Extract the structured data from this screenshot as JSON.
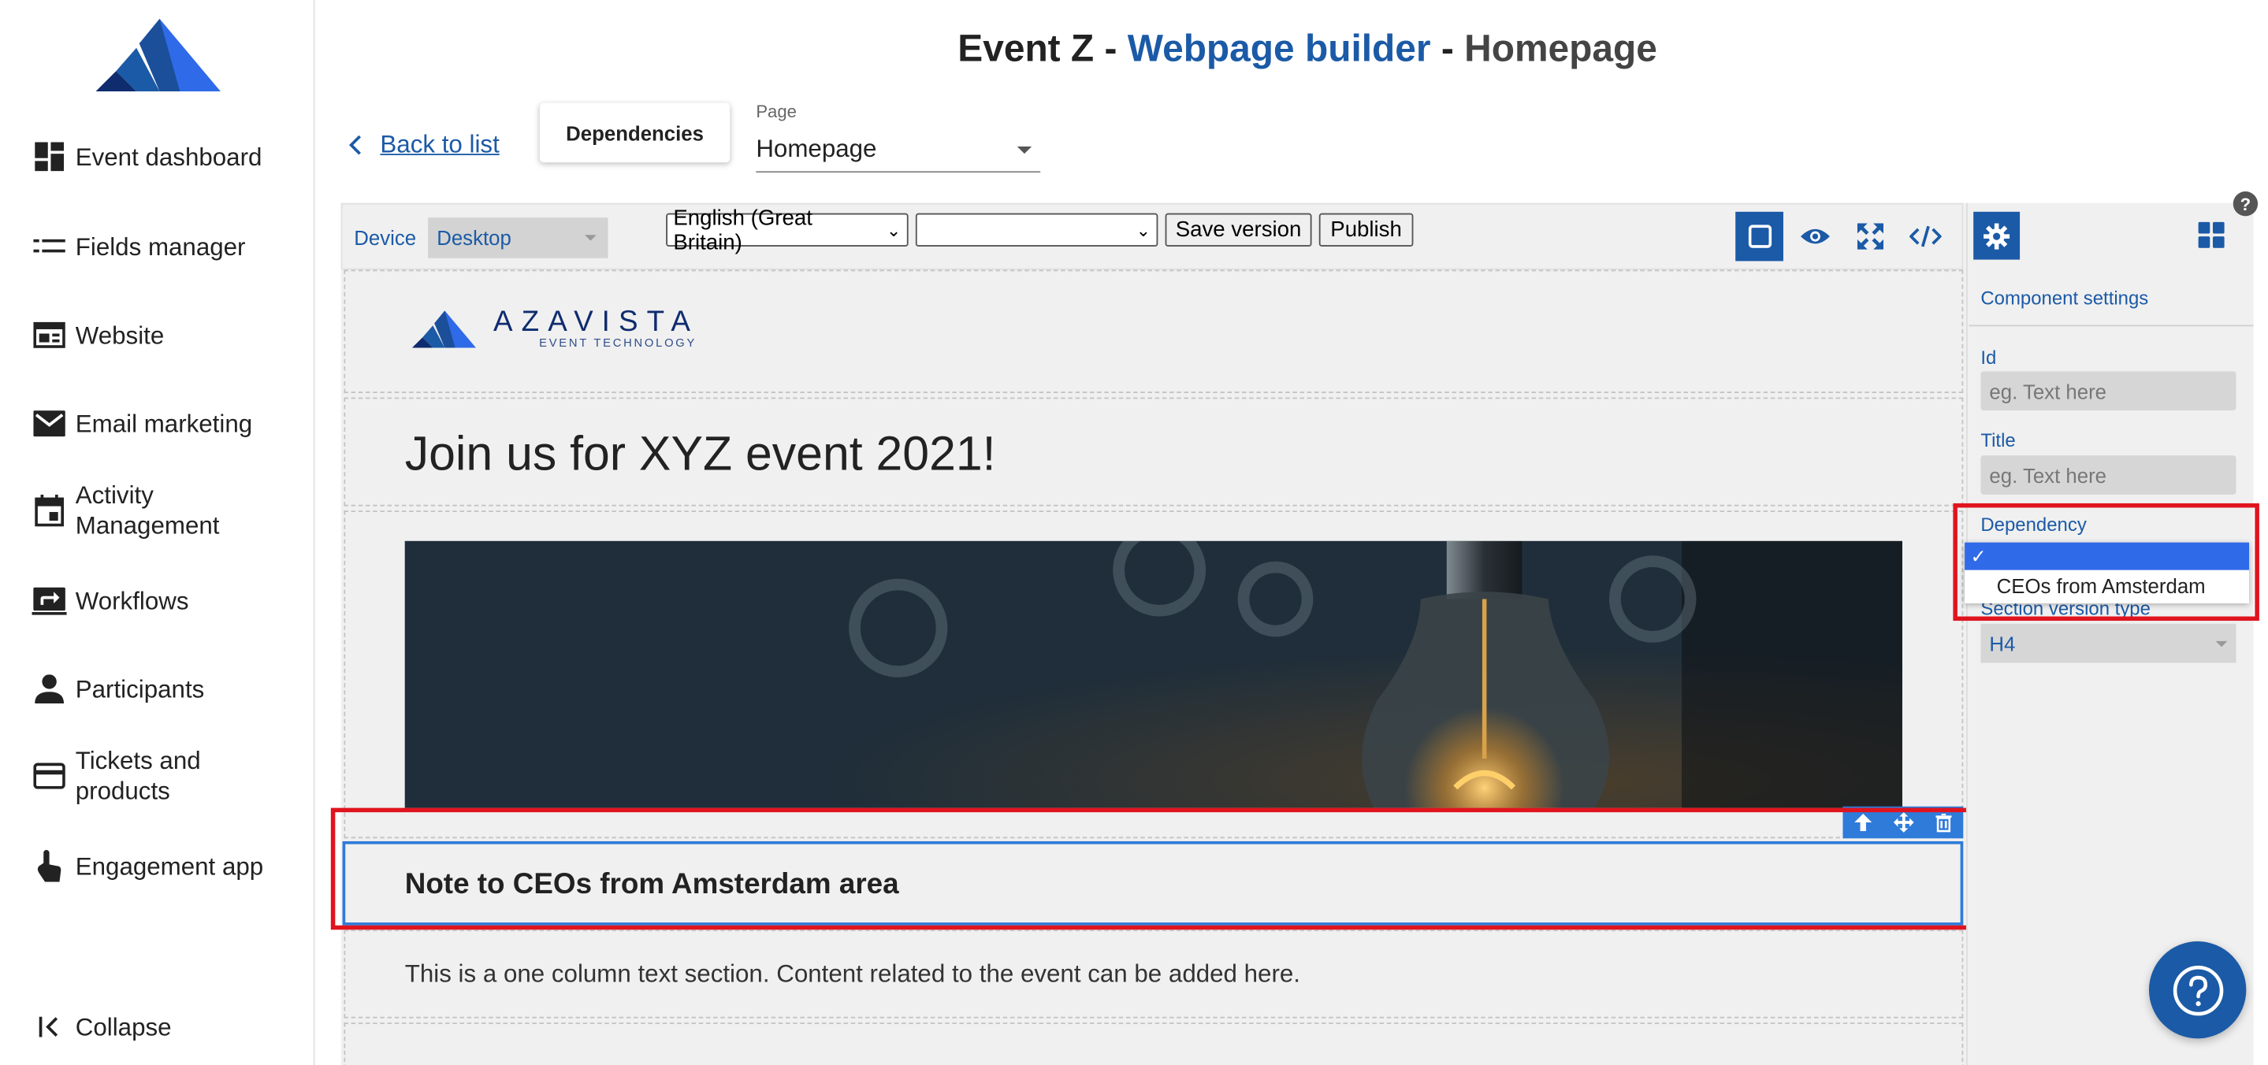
{
  "header": {
    "title_event": "Event Z",
    "title_sep1": " - ",
    "title_builder": "Webpage builder",
    "title_sep2": " - ",
    "title_page": "Homepage"
  },
  "sidebar": {
    "items": [
      {
        "label": "Event dashboard",
        "icon": "dashboard-icon"
      },
      {
        "label": "Fields manager",
        "icon": "fields-icon"
      },
      {
        "label": "Website",
        "icon": "website-icon"
      },
      {
        "label": "Email marketing",
        "icon": "mail-icon"
      },
      {
        "label": "Activity Management",
        "icon": "calendar-icon"
      },
      {
        "label": "Workflows",
        "icon": "workflow-icon"
      },
      {
        "label": "Participants",
        "icon": "person-icon"
      },
      {
        "label": "Tickets and products",
        "icon": "card-icon"
      },
      {
        "label": "Engagement app",
        "icon": "touch-icon"
      }
    ],
    "collapse": "Collapse"
  },
  "nav": {
    "back": "Back to list",
    "dependencies": "Dependencies",
    "page_label": "Page",
    "page_value": "Homepage"
  },
  "toolbar": {
    "device_label": "Device",
    "device_value": "Desktop",
    "language_value": "English (Great Britain)",
    "version_value": "",
    "save_version": "Save version",
    "publish": "Publish"
  },
  "canvas": {
    "logo_name": "AZAVISTA",
    "logo_tagline": "EVENT TECHNOLOGY",
    "headline": "Join us for XYZ event 2021!",
    "note": "Note to CEOs from Amsterdam area",
    "body": "This is a one column text section. Content related to the event can be added here."
  },
  "panel": {
    "heading": "Component settings",
    "id_label": "Id",
    "id_placeholder": "eg. Text here",
    "title_label": "Title",
    "title_placeholder": "eg. Text here",
    "dependency_label": "Dependency",
    "dependency_options": [
      "",
      "CEOs from Amsterdam"
    ],
    "section_version_label": "Section version type",
    "section_version_value": "H4"
  },
  "help": "?",
  "colors": {
    "accent": "#1b5aa6",
    "highlight": "#e0141e",
    "selection": "#2f7bd9"
  }
}
